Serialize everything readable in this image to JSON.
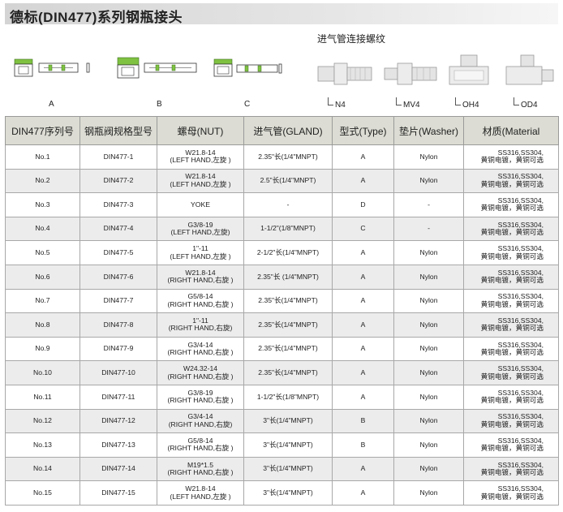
{
  "title": "德标(DIN477)系列钢瓶接头",
  "subtitle": "进气管连接螺纹",
  "fittings": [
    "A",
    "B",
    "C"
  ],
  "connectors": [
    "N4",
    "MV4",
    "OH4",
    "OD4"
  ],
  "colors": {
    "nut_green": "#7fc241",
    "header_bg": "#dcdcd4",
    "alt_row": "#ececec",
    "nut_dark": "#3f6f20"
  },
  "table": {
    "headers": [
      "DIN477序列号",
      "钢瓶阀规格型号",
      "螺母(NUT)",
      "进气管(GLAND)",
      "型式(Type)",
      "垫片(Washer)",
      "材质(Material"
    ],
    "rows": [
      {
        "no": "No.1",
        "model": "DIN477-1",
        "nut": [
          "W21.8-14",
          "(LEFT HAND,左旋 )"
        ],
        "gland": "2.35\"长(1/4\"MNPT)",
        "type": "A",
        "washer": "Nylon",
        "material": [
          "SS316,SS304,",
          "黄铜电镀，黄铜可选"
        ]
      },
      {
        "no": "No.2",
        "model": "DIN477-2",
        "nut": [
          "W21.8-14",
          "(LEFT HAND,左旋 )"
        ],
        "gland": "2.5\"长(1/4\"MNPT)",
        "type": "A",
        "washer": "Nylon",
        "material": [
          "SS316,SS304,",
          "黄铜电镀，黄铜可选"
        ]
      },
      {
        "no": "No.3",
        "model": "DIN477-3",
        "nut": [
          "YOKE",
          ""
        ],
        "gland": "-",
        "type": "D",
        "washer": "-",
        "material": [
          "SS316,SS304,",
          "黄铜电镀，黄铜可选"
        ]
      },
      {
        "no": "No.4",
        "model": "DIN477-4",
        "nut": [
          "G3/8-19",
          "(LEFT HAND,左旋)"
        ],
        "gland": "1-1/2\"(1/8\"MNPT)",
        "type": "C",
        "washer": "-",
        "material": [
          "SS316,SS304,",
          "黄铜电镀，黄铜可选"
        ]
      },
      {
        "no": "No.5",
        "model": "DIN477-5",
        "nut": [
          "1\"-11",
          "(LEFT HAND,左旋 )"
        ],
        "gland": "2-1/2\"长(1/4\"MNPT)",
        "type": "A",
        "washer": "Nylon",
        "material": [
          "SS316,SS304,",
          "黄铜电镀，黄铜可选"
        ]
      },
      {
        "no": "No.6",
        "model": "DIN477-6",
        "nut": [
          "W21.8-14",
          "(RIGHT HAND,右旋 )"
        ],
        "gland": "2.35\"长 (1/4\"MNPT)",
        "type": "A",
        "washer": "Nylon",
        "material": [
          "SS316,SS304,",
          "黄铜电镀，黄铜可选"
        ]
      },
      {
        "no": "No.7",
        "model": "DIN477-7",
        "nut": [
          "G5/8-14",
          "(RIGHT HAND,右旋 )"
        ],
        "gland": "2.35\"长(1/4\"MNPT)",
        "type": "A",
        "washer": "Nylon",
        "material": [
          "SS316,SS304,",
          "黄铜电镀，黄铜可选"
        ]
      },
      {
        "no": "No.8",
        "model": "DIN477-8",
        "nut": [
          "1\"-11",
          "(RIGHT HAND,右旋)"
        ],
        "gland": "2.35\"长(1/4\"MNPT)",
        "type": "A",
        "washer": "Nylon",
        "material": [
          "SS316,SS304,",
          "黄铜电镀，黄铜可选"
        ]
      },
      {
        "no": "No.9",
        "model": "DIN477-9",
        "nut": [
          "G3/4-14",
          "(RIGHT HAND,右旋 )"
        ],
        "gland": "2.35\"长(1/4\"MNPT)",
        "type": "A",
        "washer": "Nylon",
        "material": [
          "SS316,SS304,",
          "黄铜电镀，黄铜可选"
        ]
      },
      {
        "no": "No.10",
        "model": "DIN477-10",
        "nut": [
          "W24.32-14",
          "(RIGHT HAND,右旋 )"
        ],
        "gland": "2.35\"长(1/4\"MNPT)",
        "type": "A",
        "washer": "Nylon",
        "material": [
          "SS316,SS304,",
          "黄铜电镀，黄铜可选"
        ]
      },
      {
        "no": "No.11",
        "model": "DIN477-11",
        "nut": [
          "G3/8-19",
          "(RIGHT HAND,右旋 )"
        ],
        "gland": "1-1/2\"长(1/8\"MNPT)",
        "type": "A",
        "washer": "Nylon",
        "material": [
          "SS316,SS304,",
          "黄铜电镀，黄铜可选"
        ]
      },
      {
        "no": "No.12",
        "model": "DIN477-12",
        "nut": [
          "G3/4-14",
          "(RIGHT HAND,右旋)"
        ],
        "gland": "3\"长(1/4\"MNPT)",
        "type": "B",
        "washer": "Nylon",
        "material": [
          "SS316,SS304,",
          "黄铜电镀，黄铜可选"
        ]
      },
      {
        "no": "No.13",
        "model": "DIN477-13",
        "nut": [
          "G5/8-14",
          "(RIGHT HAND,右旋 )"
        ],
        "gland": "3\"长(1/4\"MNPT)",
        "type": "B",
        "washer": "Nylon",
        "material": [
          "SS316,SS304,",
          "黄铜电镀，黄铜可选"
        ]
      },
      {
        "no": "No.14",
        "model": "DIN477-14",
        "nut": [
          "M19*1.5",
          "(RIGHT HAND,右旋 )"
        ],
        "gland": "3\"长(1/4\"MNPT)",
        "type": "A",
        "washer": "Nylon",
        "material": [
          "SS316,SS304,",
          "黄铜电镀，黄铜可选"
        ]
      },
      {
        "no": "No.15",
        "model": "DIN477-15",
        "nut": [
          "W21.8-14",
          "(LEFT HAND,左旋 )"
        ],
        "gland": "3\"长(1/4\"MNPT)",
        "type": "A",
        "washer": "Nylon",
        "material": [
          "SS316,SS304,",
          "黄铜电镀，黄铜可选"
        ]
      }
    ]
  }
}
